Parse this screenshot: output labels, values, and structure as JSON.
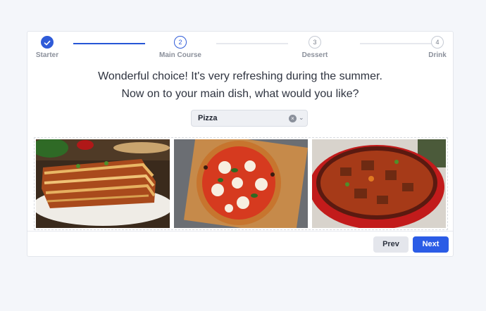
{
  "stepper": {
    "steps": [
      {
        "label": "Starter",
        "number": "",
        "state": "done"
      },
      {
        "label": "Main Course",
        "number": "2",
        "state": "current"
      },
      {
        "label": "Dessert",
        "number": "3",
        "state": "upcoming"
      },
      {
        "label": "Drink",
        "number": "4",
        "state": "upcoming"
      }
    ]
  },
  "prompt": {
    "line1": "Wonderful choice! It's very refreshing during the summer.",
    "line2": "Now on to your main dish, what would you like?"
  },
  "dish_select": {
    "value": "Pizza",
    "clear_glyph": "×",
    "chevron_glyph": "⌄"
  },
  "dish_images": [
    {
      "icon": "lasagna-image"
    },
    {
      "icon": "pizza-image"
    },
    {
      "icon": "stew-image"
    }
  ],
  "footer": {
    "prev_label": "Prev",
    "next_label": "Next"
  },
  "colors": {
    "accent": "#2b5ce6",
    "active_line": "#2656d6",
    "page_bg": "#f4f6fa"
  }
}
